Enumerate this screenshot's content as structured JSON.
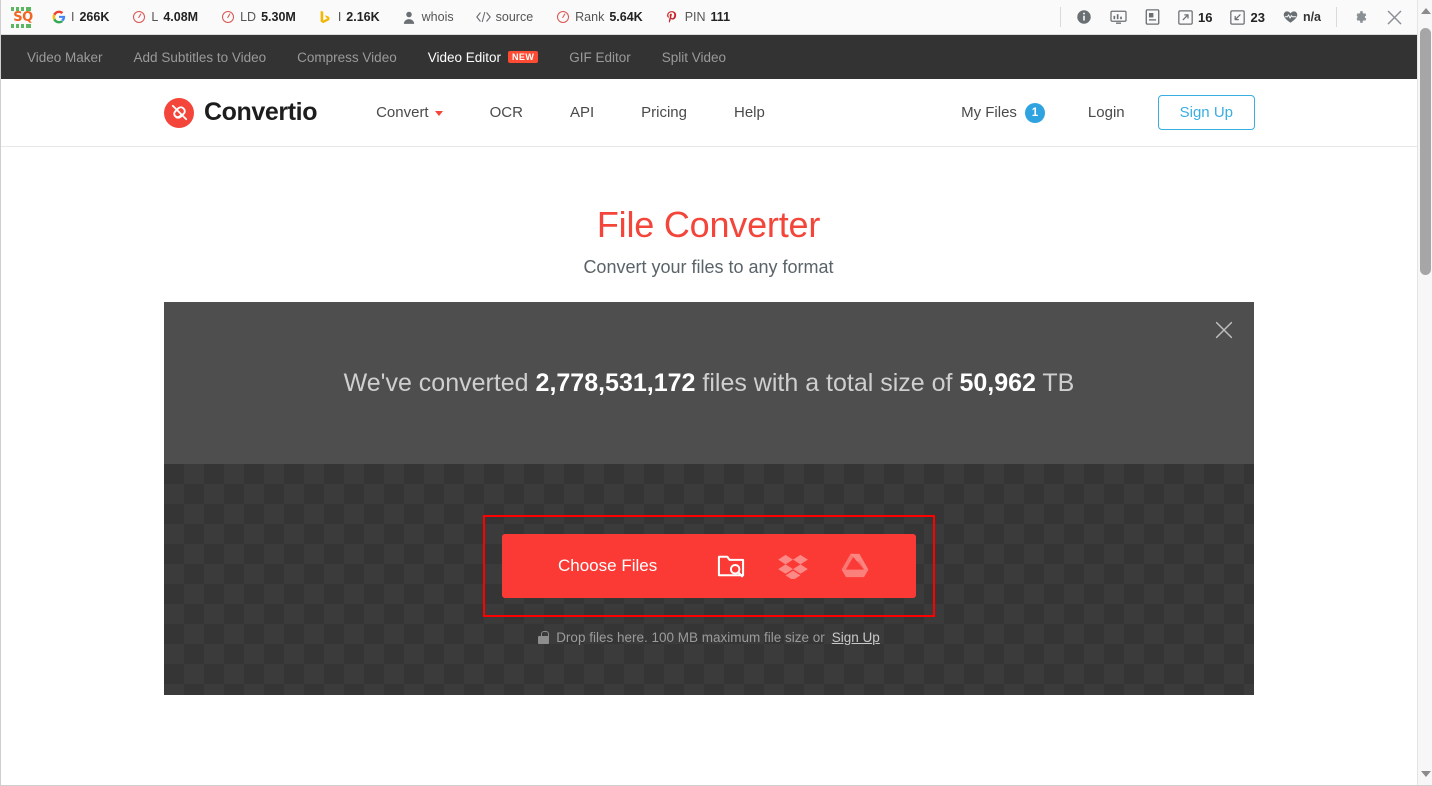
{
  "seo_toolbar": {
    "logo_text": "SQ",
    "metrics": [
      {
        "icon": "google-icon",
        "label": "I",
        "value": "266K"
      },
      {
        "icon": "alexa-ring-icon",
        "label": "L",
        "value": "4.08M"
      },
      {
        "icon": "alexa-ring-icon",
        "label": "LD",
        "value": "5.30M"
      },
      {
        "icon": "bing-icon",
        "label": "I",
        "value": "2.16K"
      },
      {
        "icon": "person-icon",
        "label": "whois",
        "value": ""
      },
      {
        "icon": "code-icon",
        "label": "source",
        "value": ""
      },
      {
        "icon": "alexa-ring-icon",
        "label": "Rank",
        "value": "5.64K"
      },
      {
        "icon": "pinterest-icon",
        "label": "PIN",
        "value": "111"
      }
    ],
    "right_icons": [
      "info-icon",
      "page-info-icon",
      "page-report-icon"
    ],
    "right_stats": [
      {
        "icon": "external-links-icon",
        "value": "16"
      },
      {
        "icon": "internal-links-icon",
        "value": "23"
      },
      {
        "icon": "health-icon",
        "value": "n/a"
      }
    ],
    "settings_icon": "gear-icon",
    "close_icon": "close-icon"
  },
  "dark_nav": {
    "items": [
      {
        "label": "Video Maker",
        "active": false,
        "badge": ""
      },
      {
        "label": "Add Subtitles to Video",
        "active": false,
        "badge": ""
      },
      {
        "label": "Compress Video",
        "active": false,
        "badge": ""
      },
      {
        "label": "Video Editor",
        "active": true,
        "badge": "NEW"
      },
      {
        "label": "GIF Editor",
        "active": false,
        "badge": ""
      },
      {
        "label": "Split Video",
        "active": false,
        "badge": ""
      }
    ]
  },
  "header": {
    "brand": "Convertio",
    "brand_icon": "convertio-logo-icon",
    "nav": [
      {
        "label": "Convert",
        "has_caret": true
      },
      {
        "label": "OCR",
        "has_caret": false
      },
      {
        "label": "API",
        "has_caret": false
      },
      {
        "label": "Pricing",
        "has_caret": false
      },
      {
        "label": "Help",
        "has_caret": false
      }
    ],
    "my_files_label": "My Files",
    "my_files_count": "1",
    "login_label": "Login",
    "signup_label": "Sign Up"
  },
  "hero": {
    "title": "File Converter",
    "subtitle": "Convert your files to any format"
  },
  "stats": {
    "prefix": "We've converted ",
    "files_count": "2,778,531,172",
    "middle": " files with a total size of ",
    "total_size": "50,962",
    "suffix": " TB",
    "close_icon": "close-icon"
  },
  "dropzone": {
    "choose_files_label": "Choose Files",
    "icons": [
      {
        "name": "folder-search-icon"
      },
      {
        "name": "dropbox-icon"
      },
      {
        "name": "google-drive-icon"
      }
    ],
    "hint_lock_icon": "lock-icon",
    "hint_text": "Drop files here. 100 MB maximum file size or ",
    "hint_link": "Sign Up"
  },
  "colors": {
    "brand_red": "#f4453a",
    "button_red": "#fb3a36",
    "highlight_outline": "#ff0000",
    "accent_blue": "#3aaee0",
    "badge_orange": "#ff4b33",
    "dark_nav": "#333333",
    "stats_bg": "#4e4e4e"
  }
}
